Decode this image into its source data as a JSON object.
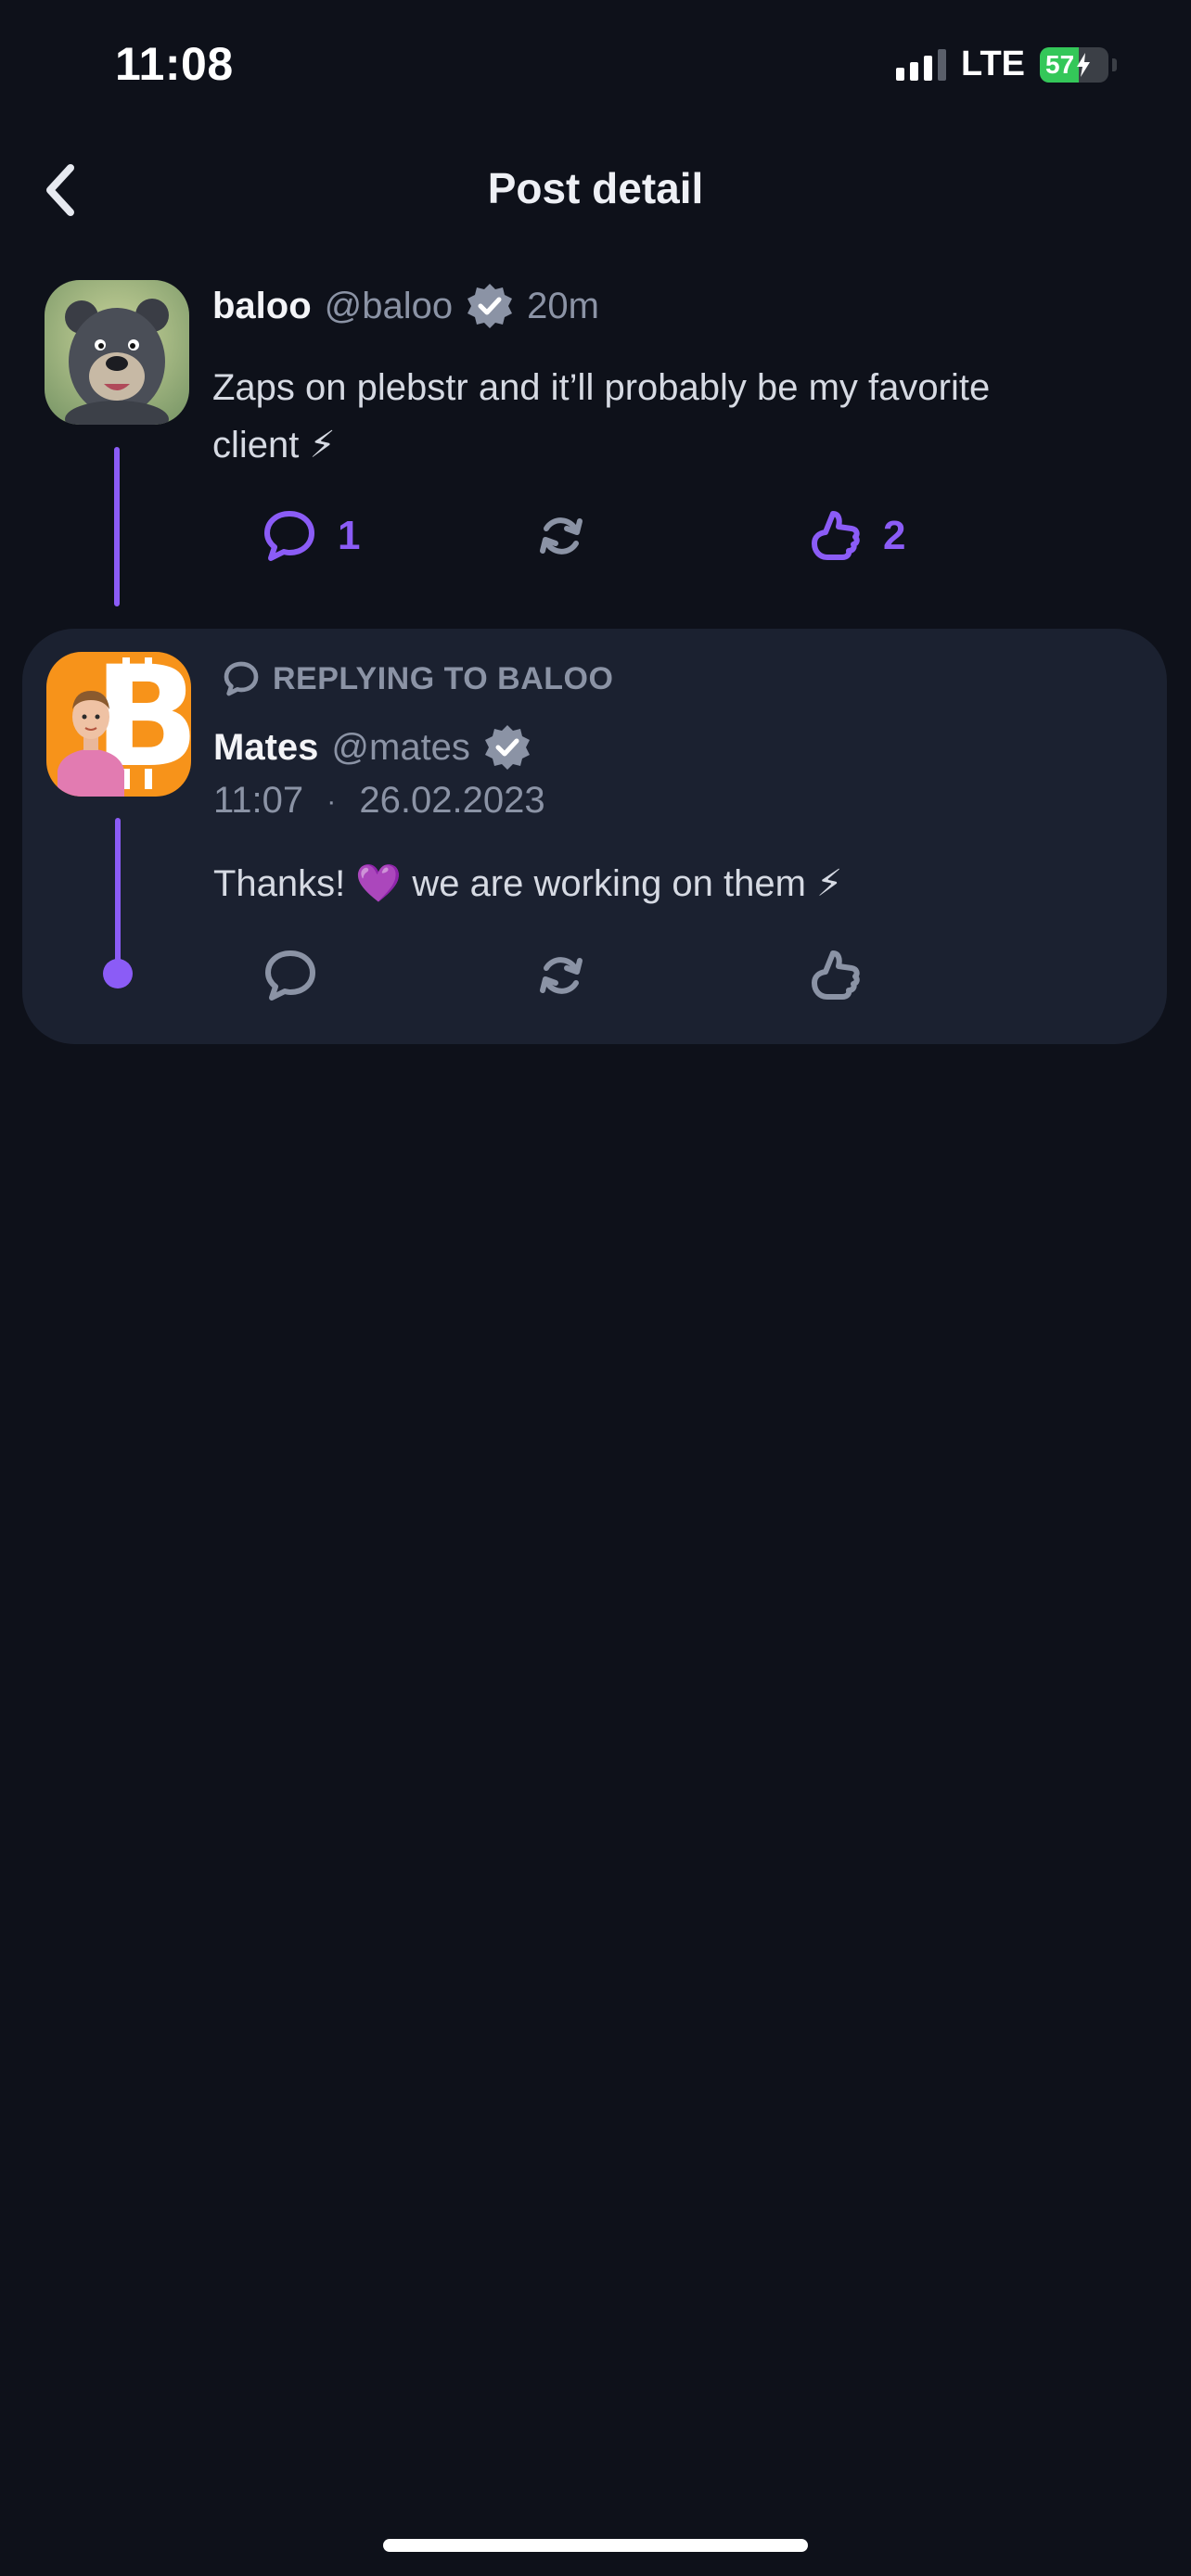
{
  "status_bar": {
    "time": "11:08",
    "network": "LTE",
    "battery": "57",
    "battery_level": 0.57
  },
  "nav": {
    "title": "Post detail",
    "back_icon": "chevron-left-icon"
  },
  "post": {
    "author_name": "baloo",
    "author_handle": "@baloo",
    "time_ago": "20m",
    "text_line1": "Zaps on plebstr and it’ll probably be my favorite",
    "text_line2": "client ⚡",
    "reply_count": "1",
    "like_count": "2"
  },
  "reply": {
    "replying_to": "REPLYING TO BALOO",
    "author_name": "Mates",
    "author_handle": "@mates",
    "time": "11:07",
    "separator": "·",
    "date": "26.02.2023",
    "text": "Thanks! 💜  we are working on them ⚡"
  },
  "colors": {
    "accent": "#8b5cf6",
    "background": "#0e111a",
    "card": "#1b2130",
    "muted": "#8b93a5",
    "bitcoin": "#f7931a"
  }
}
